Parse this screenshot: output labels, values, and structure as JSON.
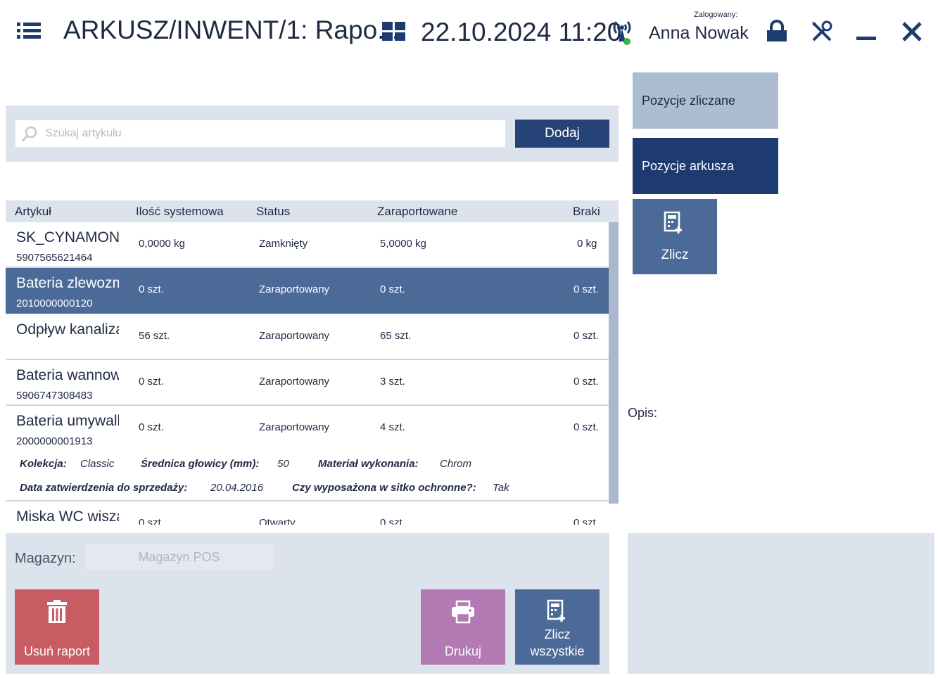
{
  "header": {
    "title": "ARKUSZ/INWENT/1: Rapo...",
    "datetime": "22.10.2024 11:20",
    "login_label": "Zalogowany:",
    "user_name": "Anna Nowak"
  },
  "search": {
    "placeholder": "Szukaj artykułu",
    "value": "",
    "add_label": "Dodaj"
  },
  "table": {
    "headers": [
      "Artykuł",
      "Ilość systemowa",
      "Status",
      "Zaraportowane",
      "Braki"
    ],
    "rows": [
      {
        "name": "SK_CYNAMON",
        "code": "5907565621464",
        "system_qty": "0,0000 kg",
        "status": "Zamknięty",
        "reported": "5,0000 kg",
        "shortage": "0 kg"
      },
      {
        "name": "Bateria zlewozmywakowa",
        "code": "2010000000120",
        "system_qty": "0 szt.",
        "status": "Zaraportowany",
        "reported": "0 szt.",
        "shortage": "0 szt."
      },
      {
        "name": "Odpływ kanalizacyjny",
        "code": "",
        "system_qty": "56 szt.",
        "status": "Zaraportowany",
        "reported": "65 szt.",
        "shortage": "0 szt."
      },
      {
        "name": "Bateria wannowa",
        "code": "5906747308483",
        "system_qty": "0 szt.",
        "status": "Zaraportowany",
        "reported": "3 szt.",
        "shortage": "0 szt."
      },
      {
        "name": "Bateria umywalkowa",
        "code": "2000000001913",
        "system_qty": "0 szt.",
        "status": "Zaraportowany",
        "reported": "4 szt.",
        "shortage": "0 szt."
      },
      {
        "name": "Miska WC wiszą",
        "code": "",
        "system_qty": "0 szt.",
        "status": "Otwarty",
        "reported": "0 szt.",
        "shortage": "0 szt."
      }
    ],
    "details": {
      "collection_label": "Kolekcja:",
      "collection_value": "Classic",
      "diameter_label": "Średnica głowicy (mm):",
      "diameter_value": "50",
      "material_label": "Materiał wykonania:",
      "material_value": "Chrom",
      "approval_label": "Data zatwierdzenia do sprzedaży:",
      "approval_value": "20.04.2016",
      "strainer_label": "Czy wyposażona w sitko ochronne?:",
      "strainer_value": "Tak"
    }
  },
  "side": {
    "tab_counted": "Pozycje zliczane",
    "tab_sheet": "Pozycje arkusza",
    "count_label": "Zlicz",
    "description_label": "Opis:"
  },
  "bottom": {
    "warehouse_label": "Magazyn:",
    "warehouse_value": "Magazyn POS",
    "delete_label": "Usuń raport",
    "print_label": "Drukuj",
    "count_all_line1": "Zlicz",
    "count_all_line2": "wszystkie"
  },
  "colors": {
    "navy": "#1e3b70",
    "selected_row": "#4b6a98",
    "panel_bg": "#dce3ec",
    "delete_red": "#c75d63",
    "print_purple": "#b279b3",
    "status_online": "#3cb043"
  }
}
